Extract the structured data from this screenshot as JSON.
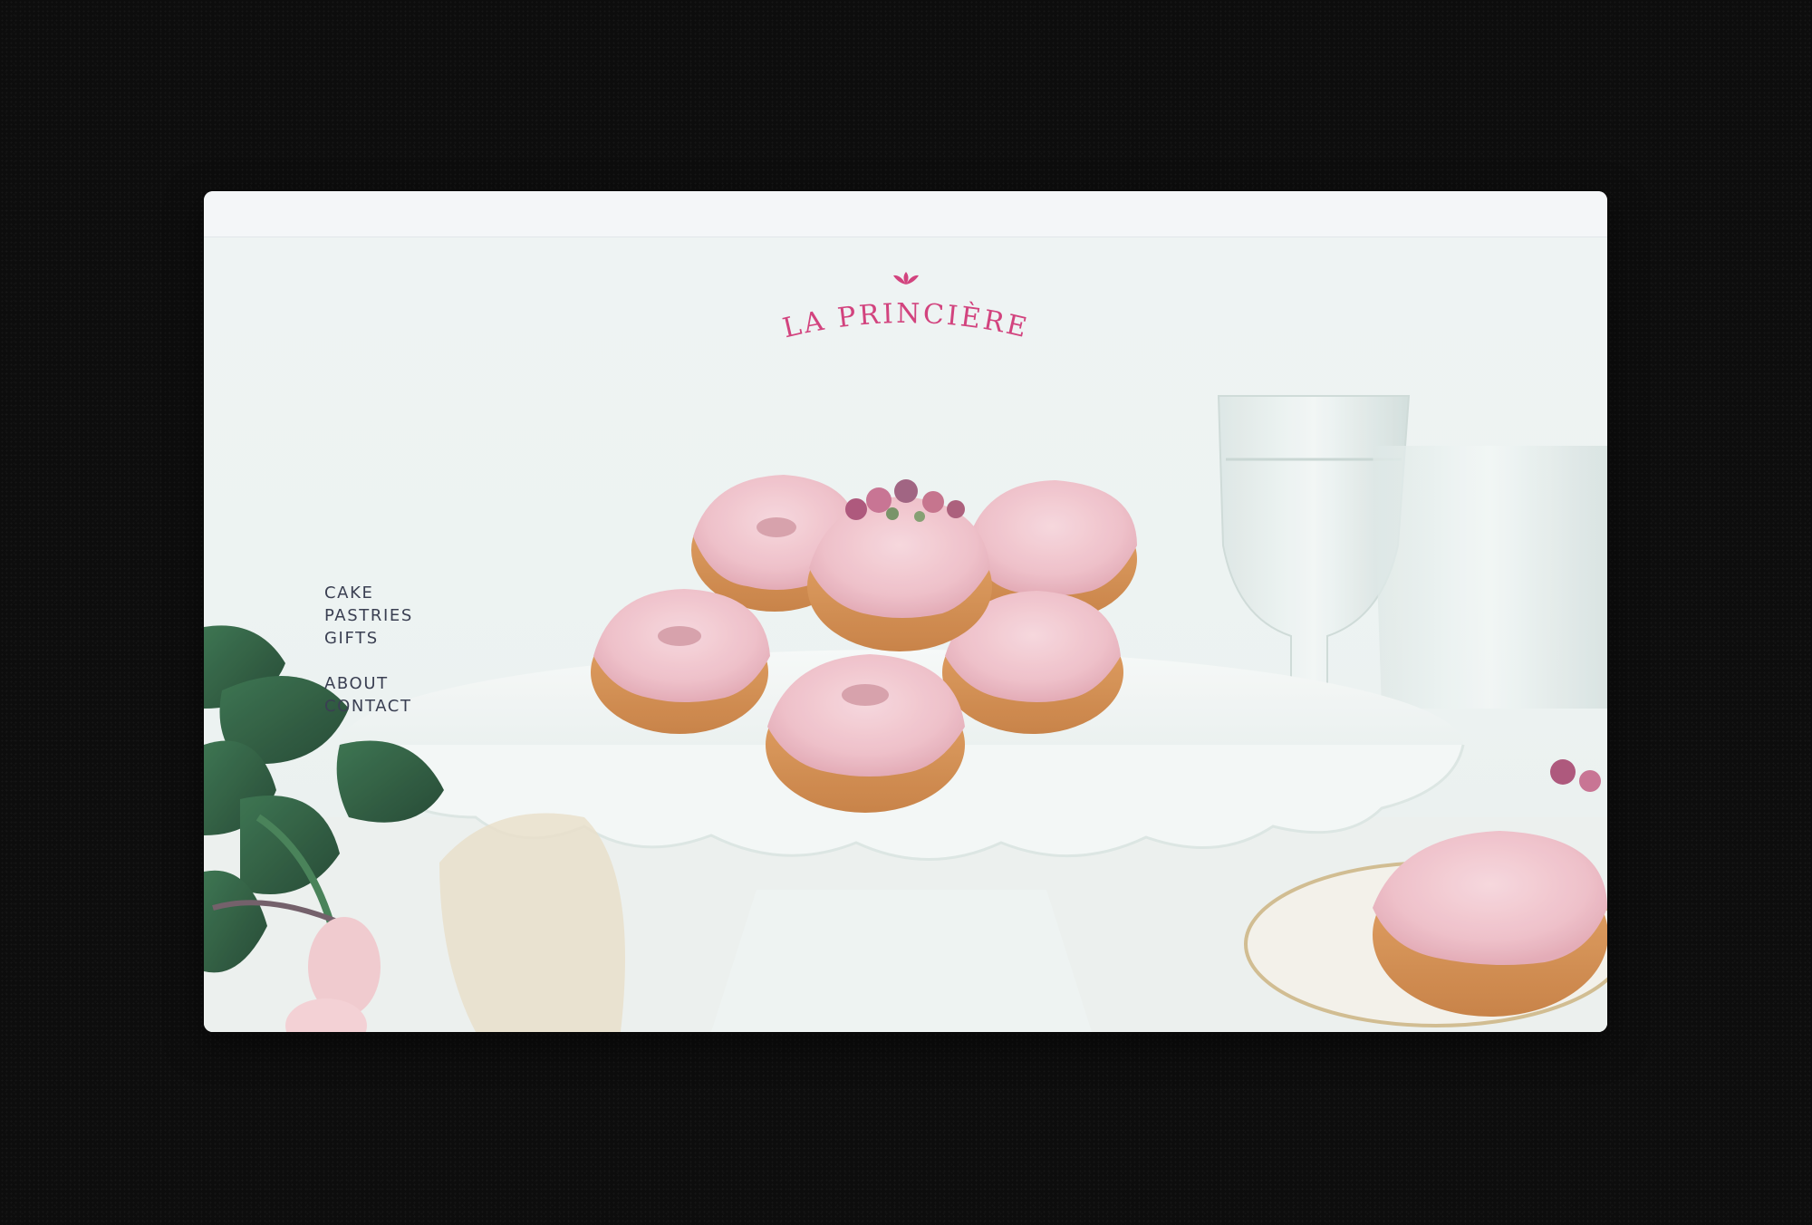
{
  "brand": {
    "name": "LA PRINCIÈRE",
    "color": "#d2437e"
  },
  "nav": {
    "primary": [
      {
        "label": "CAKE"
      },
      {
        "label": "PASTRIES"
      },
      {
        "label": "GIFTS"
      }
    ],
    "secondary": [
      {
        "label": "ABOUT"
      },
      {
        "label": "CONTACT"
      }
    ]
  },
  "icons": {
    "logo_mark": "lotus-icon"
  }
}
